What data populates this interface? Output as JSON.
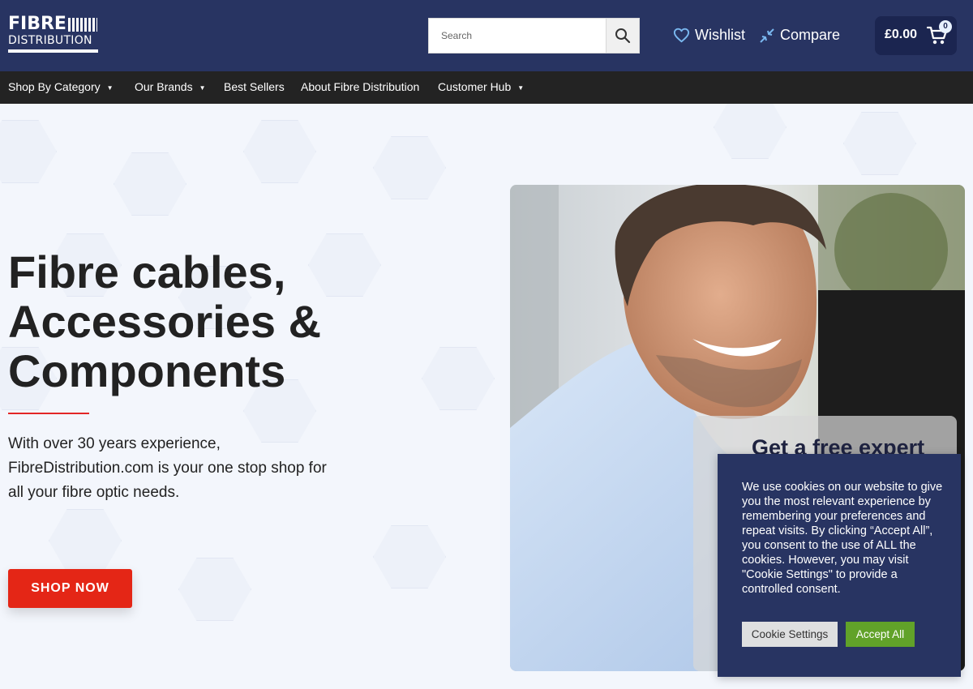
{
  "header": {
    "logo": {
      "line1": "FIBRE",
      "line2": "DISTRIBUTION"
    },
    "search": {
      "placeholder": "Search"
    },
    "wishlist_label": "Wishlist",
    "compare_label": "Compare",
    "cart": {
      "amount": "£0.00",
      "count": "0"
    },
    "icons": {
      "search": "search-icon",
      "wishlist": "heart-icon",
      "compare": "compare-arrows-icon",
      "cart": "cart-icon"
    }
  },
  "nav": {
    "items": [
      {
        "label": "Shop By Category",
        "has_dropdown": true
      },
      {
        "label": "Our Brands",
        "has_dropdown": true
      },
      {
        "label": "Best Sellers",
        "has_dropdown": false
      },
      {
        "label": "About Fibre Distribution",
        "has_dropdown": false
      },
      {
        "label": "Customer Hub",
        "has_dropdown": true
      }
    ],
    "caret": "▼"
  },
  "hero": {
    "headline_lines": [
      "Fibre cables,",
      "Accessories &",
      "Components"
    ],
    "subtext_lines": [
      "With over 30 years experience,",
      "FibreDistribution.com is your one stop shop for",
      "all your fibre optic needs."
    ],
    "cta_label": "SHOP NOW",
    "expert_card_title": "Get a free expert"
  },
  "cookie_banner": {
    "text": "We use cookies on our website to give you the most relevant experience by remembering your preferences and repeat visits. By clicking “Accept All”, you consent to the use of ALL the cookies. However, you may visit \"Cookie Settings\" to provide a controlled consent.",
    "settings_label": "Cookie Settings",
    "accept_label": "Accept All"
  },
  "colors": {
    "header_bg": "#283462",
    "nav_bg": "#232323",
    "hero_bg": "#f3f6fc",
    "accent_red": "#e42616",
    "accept_green": "#61a229",
    "cart_bg": "#1b2550"
  }
}
